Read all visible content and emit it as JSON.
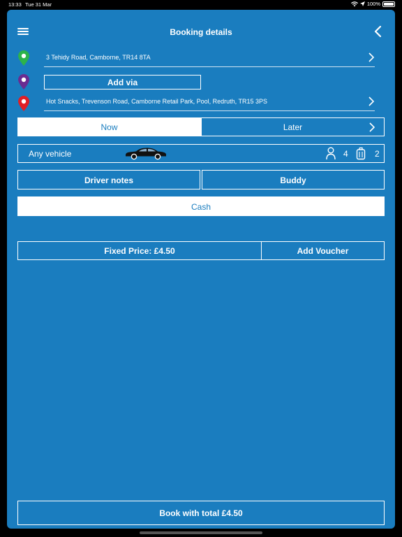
{
  "status_bar": {
    "time": "13:33",
    "date": "Tue 31 Mar",
    "battery": "100%"
  },
  "header": {
    "title": "Booking details"
  },
  "route": {
    "pickup": "3 Tehidy Road, Camborne, TR14 8TA",
    "via_button": "Add via",
    "destination": "Hot Snacks, Trevenson Road, Camborne Retail Park, Pool, Redruth, TR15 3PS"
  },
  "timing": {
    "now_label": "Now",
    "later_label": "Later"
  },
  "vehicle": {
    "label": "Any vehicle",
    "passengers": "4",
    "luggage": "2"
  },
  "options": {
    "driver_notes": "Driver notes",
    "buddy": "Buddy"
  },
  "payment": {
    "method": "Cash"
  },
  "price": {
    "fixed_price": "Fixed Price: £4.50",
    "add_voucher": "Add Voucher"
  },
  "footer": {
    "book_button": "Book with total £4.50"
  },
  "colors": {
    "background": "#1a7dbf",
    "pickup_pin": "#2db34a",
    "via_pin": "#6a2c91",
    "destination_pin": "#e01f26"
  }
}
